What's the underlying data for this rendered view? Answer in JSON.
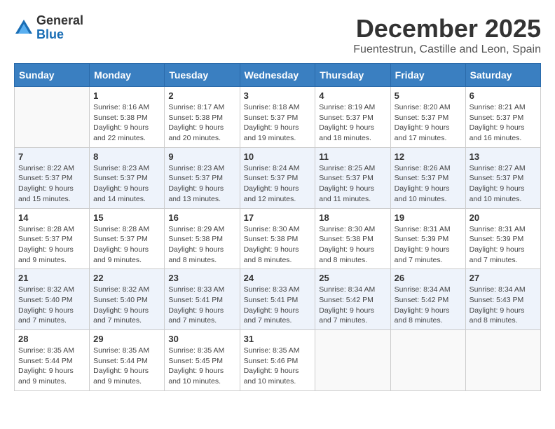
{
  "header": {
    "logo_line1": "General",
    "logo_line2": "Blue",
    "month": "December 2025",
    "location": "Fuentestrun, Castille and Leon, Spain"
  },
  "weekdays": [
    "Sunday",
    "Monday",
    "Tuesday",
    "Wednesday",
    "Thursday",
    "Friday",
    "Saturday"
  ],
  "weeks": [
    [
      {
        "day": "",
        "info": ""
      },
      {
        "day": "1",
        "info": "Sunrise: 8:16 AM\nSunset: 5:38 PM\nDaylight: 9 hours\nand 22 minutes."
      },
      {
        "day": "2",
        "info": "Sunrise: 8:17 AM\nSunset: 5:38 PM\nDaylight: 9 hours\nand 20 minutes."
      },
      {
        "day": "3",
        "info": "Sunrise: 8:18 AM\nSunset: 5:37 PM\nDaylight: 9 hours\nand 19 minutes."
      },
      {
        "day": "4",
        "info": "Sunrise: 8:19 AM\nSunset: 5:37 PM\nDaylight: 9 hours\nand 18 minutes."
      },
      {
        "day": "5",
        "info": "Sunrise: 8:20 AM\nSunset: 5:37 PM\nDaylight: 9 hours\nand 17 minutes."
      },
      {
        "day": "6",
        "info": "Sunrise: 8:21 AM\nSunset: 5:37 PM\nDaylight: 9 hours\nand 16 minutes."
      }
    ],
    [
      {
        "day": "7",
        "info": "Sunrise: 8:22 AM\nSunset: 5:37 PM\nDaylight: 9 hours\nand 15 minutes."
      },
      {
        "day": "8",
        "info": "Sunrise: 8:23 AM\nSunset: 5:37 PM\nDaylight: 9 hours\nand 14 minutes."
      },
      {
        "day": "9",
        "info": "Sunrise: 8:23 AM\nSunset: 5:37 PM\nDaylight: 9 hours\nand 13 minutes."
      },
      {
        "day": "10",
        "info": "Sunrise: 8:24 AM\nSunset: 5:37 PM\nDaylight: 9 hours\nand 12 minutes."
      },
      {
        "day": "11",
        "info": "Sunrise: 8:25 AM\nSunset: 5:37 PM\nDaylight: 9 hours\nand 11 minutes."
      },
      {
        "day": "12",
        "info": "Sunrise: 8:26 AM\nSunset: 5:37 PM\nDaylight: 9 hours\nand 10 minutes."
      },
      {
        "day": "13",
        "info": "Sunrise: 8:27 AM\nSunset: 5:37 PM\nDaylight: 9 hours\nand 10 minutes."
      }
    ],
    [
      {
        "day": "14",
        "info": "Sunrise: 8:28 AM\nSunset: 5:37 PM\nDaylight: 9 hours\nand 9 minutes."
      },
      {
        "day": "15",
        "info": "Sunrise: 8:28 AM\nSunset: 5:37 PM\nDaylight: 9 hours\nand 9 minutes."
      },
      {
        "day": "16",
        "info": "Sunrise: 8:29 AM\nSunset: 5:38 PM\nDaylight: 9 hours\nand 8 minutes."
      },
      {
        "day": "17",
        "info": "Sunrise: 8:30 AM\nSunset: 5:38 PM\nDaylight: 9 hours\nand 8 minutes."
      },
      {
        "day": "18",
        "info": "Sunrise: 8:30 AM\nSunset: 5:38 PM\nDaylight: 9 hours\nand 8 minutes."
      },
      {
        "day": "19",
        "info": "Sunrise: 8:31 AM\nSunset: 5:39 PM\nDaylight: 9 hours\nand 7 minutes."
      },
      {
        "day": "20",
        "info": "Sunrise: 8:31 AM\nSunset: 5:39 PM\nDaylight: 9 hours\nand 7 minutes."
      }
    ],
    [
      {
        "day": "21",
        "info": "Sunrise: 8:32 AM\nSunset: 5:40 PM\nDaylight: 9 hours\nand 7 minutes."
      },
      {
        "day": "22",
        "info": "Sunrise: 8:32 AM\nSunset: 5:40 PM\nDaylight: 9 hours\nand 7 minutes."
      },
      {
        "day": "23",
        "info": "Sunrise: 8:33 AM\nSunset: 5:41 PM\nDaylight: 9 hours\nand 7 minutes."
      },
      {
        "day": "24",
        "info": "Sunrise: 8:33 AM\nSunset: 5:41 PM\nDaylight: 9 hours\nand 7 minutes."
      },
      {
        "day": "25",
        "info": "Sunrise: 8:34 AM\nSunset: 5:42 PM\nDaylight: 9 hours\nand 7 minutes."
      },
      {
        "day": "26",
        "info": "Sunrise: 8:34 AM\nSunset: 5:42 PM\nDaylight: 9 hours\nand 8 minutes."
      },
      {
        "day": "27",
        "info": "Sunrise: 8:34 AM\nSunset: 5:43 PM\nDaylight: 9 hours\nand 8 minutes."
      }
    ],
    [
      {
        "day": "28",
        "info": "Sunrise: 8:35 AM\nSunset: 5:44 PM\nDaylight: 9 hours\nand 9 minutes."
      },
      {
        "day": "29",
        "info": "Sunrise: 8:35 AM\nSunset: 5:44 PM\nDaylight: 9 hours\nand 9 minutes."
      },
      {
        "day": "30",
        "info": "Sunrise: 8:35 AM\nSunset: 5:45 PM\nDaylight: 9 hours\nand 10 minutes."
      },
      {
        "day": "31",
        "info": "Sunrise: 8:35 AM\nSunset: 5:46 PM\nDaylight: 9 hours\nand 10 minutes."
      },
      {
        "day": "",
        "info": ""
      },
      {
        "day": "",
        "info": ""
      },
      {
        "day": "",
        "info": ""
      }
    ]
  ]
}
